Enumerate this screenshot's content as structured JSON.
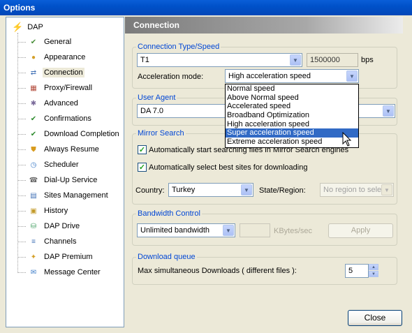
{
  "window": {
    "title": "Options"
  },
  "tree": {
    "root": {
      "label": "DAP"
    },
    "items": [
      {
        "label": "General",
        "icon": "general-icon",
        "color": "#4a8f3a"
      },
      {
        "label": "Appearance",
        "icon": "appearance-icon",
        "color": "#d4a02a"
      },
      {
        "label": "Connection",
        "icon": "connection-icon",
        "color": "#3f6fb5",
        "selected": true
      },
      {
        "label": "Proxy/Firewall",
        "icon": "firewall-icon",
        "color": "#b24a3a"
      },
      {
        "label": "Advanced",
        "icon": "advanced-icon",
        "color": "#7a6a9a"
      },
      {
        "label": "Confirmations",
        "icon": "checkmark-icon",
        "color": "#2e8b2e"
      },
      {
        "label": "Download Completion",
        "icon": "checkmark-icon",
        "color": "#2e8b2e"
      },
      {
        "label": "Always Resume",
        "icon": "resume-icon",
        "color": "#d89b1e"
      },
      {
        "label": "Scheduler",
        "icon": "clock-icon",
        "color": "#3a7bc8"
      },
      {
        "label": "Dial-Up Service",
        "icon": "phone-icon",
        "color": "#6a6a6a"
      },
      {
        "label": "Sites Management",
        "icon": "sites-icon",
        "color": "#3f6fb5"
      },
      {
        "label": "History",
        "icon": "history-icon",
        "color": "#c29a2a"
      },
      {
        "label": "DAP Drive",
        "icon": "drive-icon",
        "color": "#3a9a5a"
      },
      {
        "label": "Channels",
        "icon": "channels-icon",
        "color": "#3f6fb5"
      },
      {
        "label": "DAP Premium",
        "icon": "premium-icon",
        "color": "#d4a02a"
      },
      {
        "label": "Message Center",
        "icon": "message-icon",
        "color": "#3a7bc8"
      }
    ]
  },
  "panel": {
    "title": "Connection"
  },
  "connection": {
    "legend": "Connection Type/Speed",
    "type_value": "T1",
    "speed_value": "1500000",
    "speed_unit": "bps",
    "accel_label": "Acceleration mode:",
    "accel_value": "High acceleration speed",
    "accel_options": [
      "Normal speed",
      "Above Normal speed",
      "Accelerated speed",
      "Broadband Optimization",
      "High acceleration speed",
      "Super acceleration speed",
      "Extreme acceleration speed"
    ],
    "accel_highlighted": "Super acceleration speed"
  },
  "user_agent": {
    "legend": "User Agent",
    "value": "DA 7.0"
  },
  "mirror": {
    "legend": "Mirror Search",
    "auto_search_label": "Automatically start searching files in Mirror Search engines",
    "auto_search_checked": true,
    "auto_select_label": "Automatically select best sites for downloading",
    "auto_select_checked": true,
    "country_label": "Country:",
    "country_value": "Turkey",
    "state_label": "State/Region:",
    "state_value": "No region to sele"
  },
  "bandwidth": {
    "legend": "Bandwidth Control",
    "value": "Unlimited bandwidth",
    "unit_label": "KBytes/sec",
    "apply_label": "Apply"
  },
  "queue": {
    "legend": "Download queue",
    "max_label": "Max simultaneous Downloads ( different files ):",
    "max_value": "5"
  },
  "buttons": {
    "close_label": "Close"
  },
  "colors": {
    "accent": "#0046d5",
    "highlight": "#316ac5",
    "titlebar": "#0051c9"
  }
}
